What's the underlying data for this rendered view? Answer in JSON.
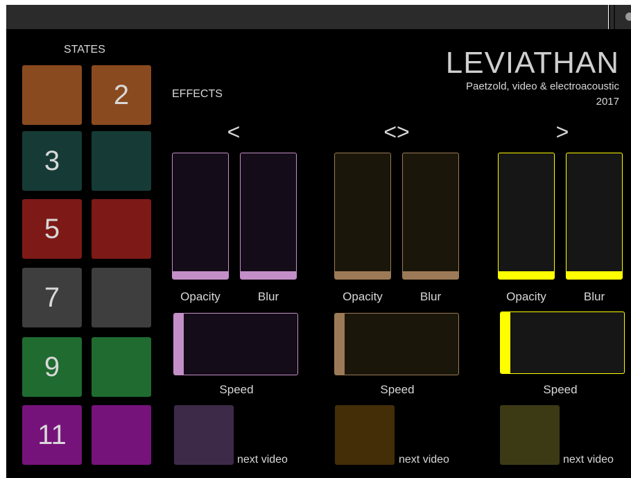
{
  "header": {
    "title": "LEVIATHAN",
    "subtitle": "Paetzold, video & electroacoustic",
    "year": "2017"
  },
  "states": {
    "label": "STATES",
    "buttons": [
      {
        "label": "",
        "color": "#8a4a1f"
      },
      {
        "label": "2",
        "color": "#8a4a1f"
      },
      {
        "label": "3",
        "color": "#163b36"
      },
      {
        "label": "",
        "color": "#163b36"
      },
      {
        "label": "5",
        "color": "#7d1a17"
      },
      {
        "label": "",
        "color": "#7d1a17"
      },
      {
        "label": "7",
        "color": "#3e3e3e"
      },
      {
        "label": "",
        "color": "#3e3e3e"
      },
      {
        "label": "9",
        "color": "#1f6b30"
      },
      {
        "label": "",
        "color": "#1f6b30"
      },
      {
        "label": "11",
        "color": "#76137a"
      },
      {
        "label": "",
        "color": "#76137a"
      }
    ]
  },
  "effects": {
    "label": "EFFECTS",
    "groups": [
      {
        "arrow": "<",
        "accent": "#c48fc8",
        "bg": "#140c18",
        "opacity_label": "Opacity",
        "opacity_value": 0.06,
        "blur_label": "Blur",
        "blur_value": 0.06,
        "speed_label": "Speed",
        "speed_value": 0.08,
        "next_label": "next video",
        "next_color": "#3d2a48"
      },
      {
        "arrow": "<>",
        "accent": "#9c7a57",
        "bg": "#1a170a",
        "opacity_label": "Opacity",
        "opacity_value": 0.06,
        "blur_label": "Blur",
        "blur_value": 0.06,
        "speed_label": "Speed",
        "speed_value": 0.08,
        "next_label": "next video",
        "next_color": "#432e08"
      },
      {
        "arrow": ">",
        "accent": "#ffff00",
        "bg": "#161616",
        "opacity_label": "Opacity",
        "opacity_value": 0.06,
        "blur_label": "Blur",
        "blur_value": 0.06,
        "speed_label": "Speed",
        "speed_value": 0.08,
        "next_label": "next video",
        "next_color": "#3c3a14"
      }
    ]
  }
}
